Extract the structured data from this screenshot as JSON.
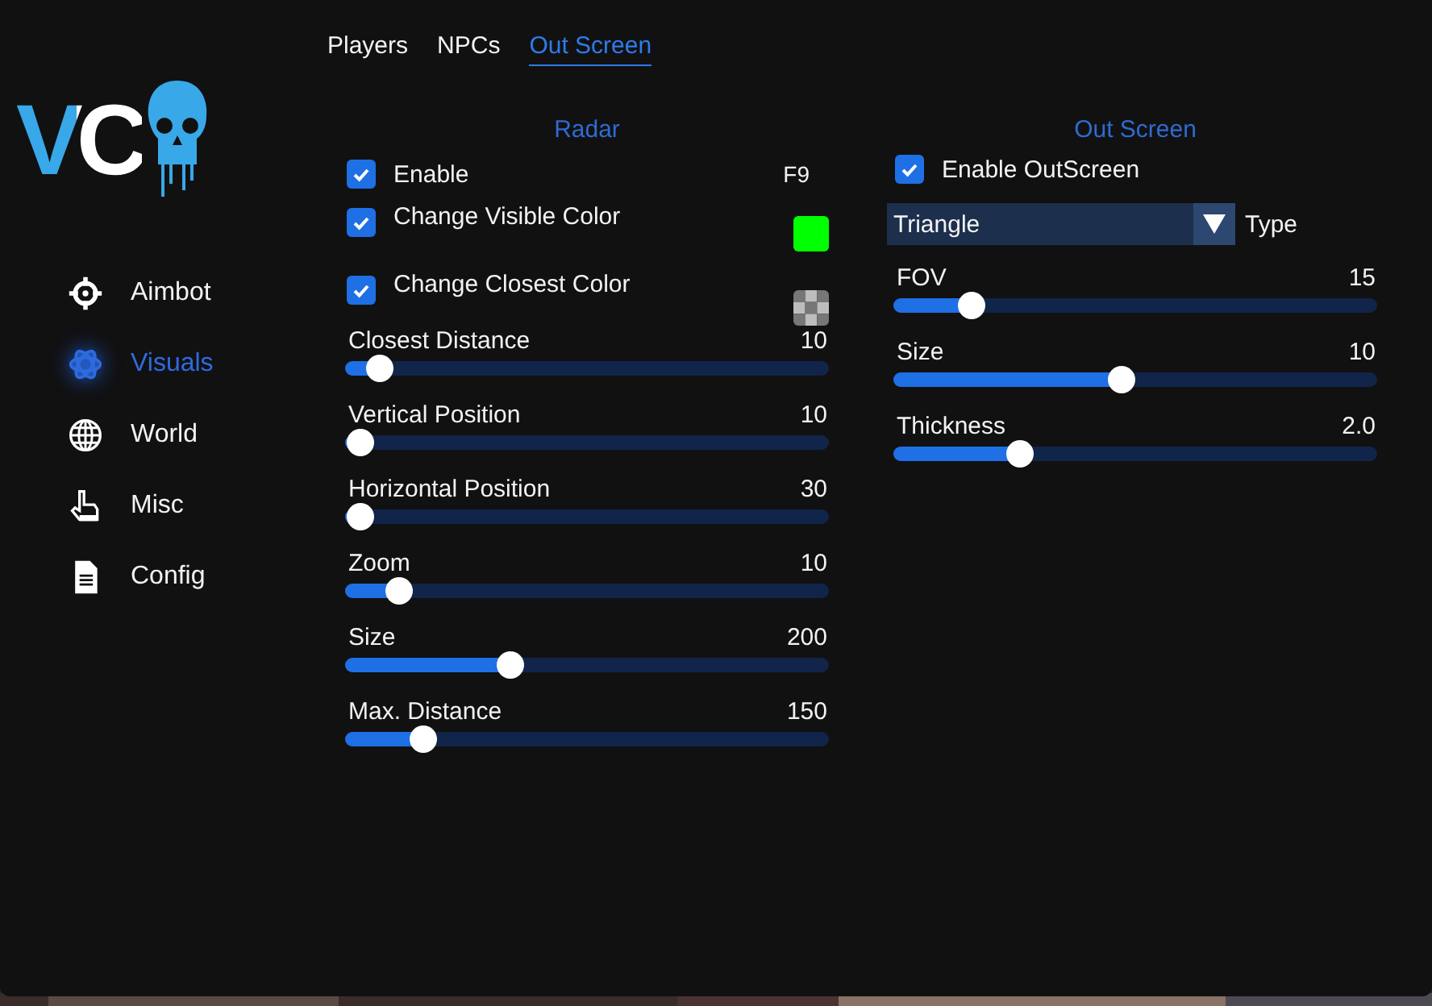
{
  "logo": {
    "text": "VC"
  },
  "sidebar": {
    "items": [
      {
        "label": "Aimbot",
        "selected": false
      },
      {
        "label": "Visuals",
        "selected": true
      },
      {
        "label": "World",
        "selected": false
      },
      {
        "label": "Misc",
        "selected": false
      },
      {
        "label": "Config",
        "selected": false
      }
    ]
  },
  "tabs": [
    {
      "label": "Players",
      "selected": false
    },
    {
      "label": "NPCs",
      "selected": false
    },
    {
      "label": "Out Screen",
      "selected": true
    }
  ],
  "radar": {
    "title": "Radar",
    "rows": [
      {
        "kind": "hotkey",
        "label": "Enable",
        "checked": true,
        "key": "F9"
      },
      {
        "kind": "swatch",
        "label": "Change Visible Color",
        "checked": true,
        "color": "#00ff00"
      },
      {
        "kind": "clear-swatch",
        "label": "Change Closest Color",
        "checked": true
      }
    ],
    "sliders": [
      {
        "label": "Closest Distance",
        "reading": "10",
        "level": 0.07
      },
      {
        "label": "Vertical Position",
        "reading": "10",
        "level": 0.03
      },
      {
        "label": "Horizontal Position",
        "reading": "30",
        "level": 0.03
      },
      {
        "label": "Zoom",
        "reading": "10",
        "level": 0.11
      },
      {
        "label": "Size",
        "reading": "200",
        "level": 0.34
      },
      {
        "label": "Max. Distance",
        "reading": "150",
        "level": 0.16
      }
    ]
  },
  "out_screen": {
    "title": "Out Screen",
    "rows": [
      {
        "kind": "plain",
        "label": "Enable OutScreen",
        "checked": true
      }
    ],
    "dropdown": {
      "value": "Triangle",
      "label": "Type"
    },
    "sliders": [
      {
        "label": "FOV",
        "reading": "15",
        "level": 0.16
      },
      {
        "label": "Size",
        "reading": "10",
        "level": 0.47
      },
      {
        "label": "Thickness",
        "reading": "2.0",
        "level": 0.26
      }
    ]
  }
}
